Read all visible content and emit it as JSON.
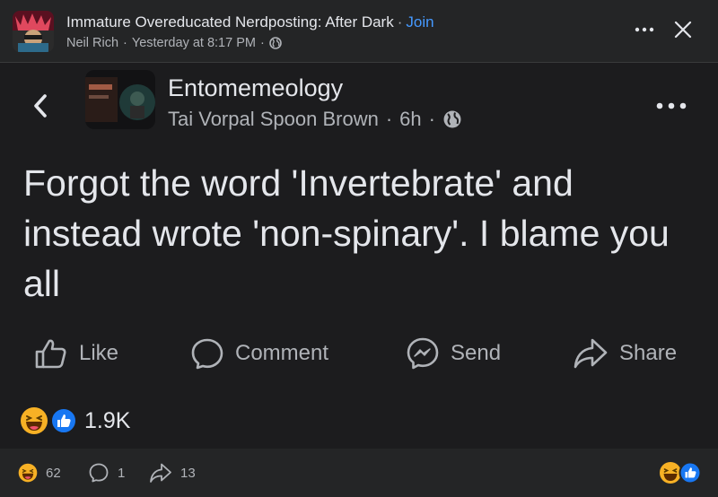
{
  "outer": {
    "group_name": "Immature Overeducated Nerdposting: After Dark",
    "separator": "·",
    "join_label": "Join",
    "author": "Neil Rich",
    "meta_separator": "·",
    "timestamp": "Yesterday at 8:17 PM",
    "meta_separator2": "·",
    "privacy_icon": "globe-icon",
    "more_icon": "more-horizontal-icon",
    "close_icon": "close-icon"
  },
  "shared_post": {
    "back_icon": "chevron-left-icon",
    "page_name": "Entomemeology",
    "author": "Tai Vorpal Spoon Brown",
    "sep1": "·",
    "age": "6h",
    "sep2": "·",
    "privacy_icon": "globe-icon",
    "more_icon": "more-horizontal-icon",
    "text": "Forgot the word 'Invertebrate' and instead wrote 'non-spinary'. I blame you all",
    "actions": {
      "like": "Like",
      "comment": "Comment",
      "send": "Send",
      "share": "Share"
    },
    "reaction_count": "1.9K"
  },
  "footer": {
    "reaction_count": "62",
    "comment_count": "1",
    "share_count": "13"
  },
  "colors": {
    "background": "#242526",
    "card": "#1c1c1e",
    "link": "#4599ff",
    "like_blue": "#1877f2",
    "haha_yellow": "#f7b125"
  }
}
